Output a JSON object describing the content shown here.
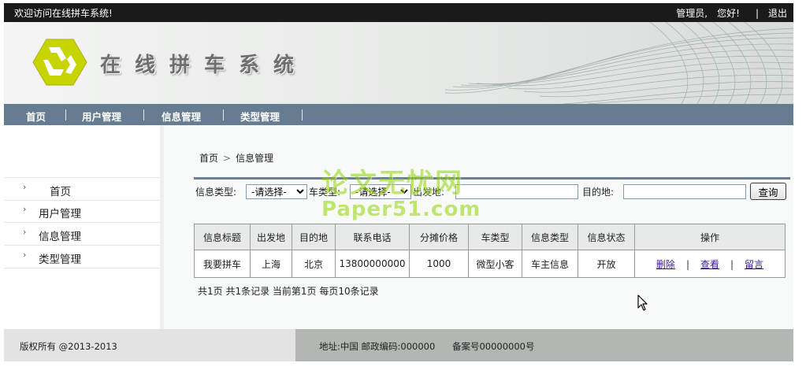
{
  "topbar": {
    "welcome": "欢迎访问在线拼车系统!",
    "user_label": "管理员,",
    "greeting": "您好!",
    "separator": "|",
    "logout": "退出"
  },
  "header": {
    "site_title": "在线拼车系统"
  },
  "nav": {
    "items": [
      "首页",
      "用户管理",
      "信息管理",
      "类型管理"
    ]
  },
  "sidebar": {
    "items": [
      "首页",
      "用户管理",
      "信息管理",
      "类型管理"
    ]
  },
  "breadcrumb": {
    "home": "首页",
    "current": "信息管理"
  },
  "filters": {
    "info_type_label": "信息类型:",
    "info_type_value": "-请选择-",
    "car_type_label": "车类型:",
    "car_type_value": "-请选择-",
    "origin_label": "出发地:",
    "origin_value": "",
    "destination_label": "目的地:",
    "destination_value": "",
    "query_button": "查询"
  },
  "table": {
    "headers": [
      "信息标题",
      "出发地",
      "目的地",
      "联系电话",
      "分摊价格",
      "车类型",
      "信息类型",
      "信息状态",
      "操作"
    ],
    "rows": [
      {
        "title": "我要拼车",
        "origin": "上海",
        "destination": "北京",
        "phone": "13800000000",
        "price": "1000",
        "car_type": "微型小客",
        "info_type": "车主信息",
        "status": "开放",
        "actions": [
          "删除",
          "查看",
          "留言"
        ]
      }
    ]
  },
  "pager": {
    "text": "共1页 共1条记录 当前第1页 每页10条记录"
  },
  "watermark": {
    "line1": "论文无忧网",
    "line2": "Paper51.com"
  },
  "footer": {
    "copyright": "版权所有 @2013-2013",
    "address": "地址:中国 邮政编码:000000",
    "record": "备案号00000000号"
  },
  "colors": {
    "topbar": "#1a1a1a",
    "nav": "#667c90",
    "logo": "#c8d400",
    "watermark": "#8fd400",
    "link": "#3b1a8c"
  }
}
